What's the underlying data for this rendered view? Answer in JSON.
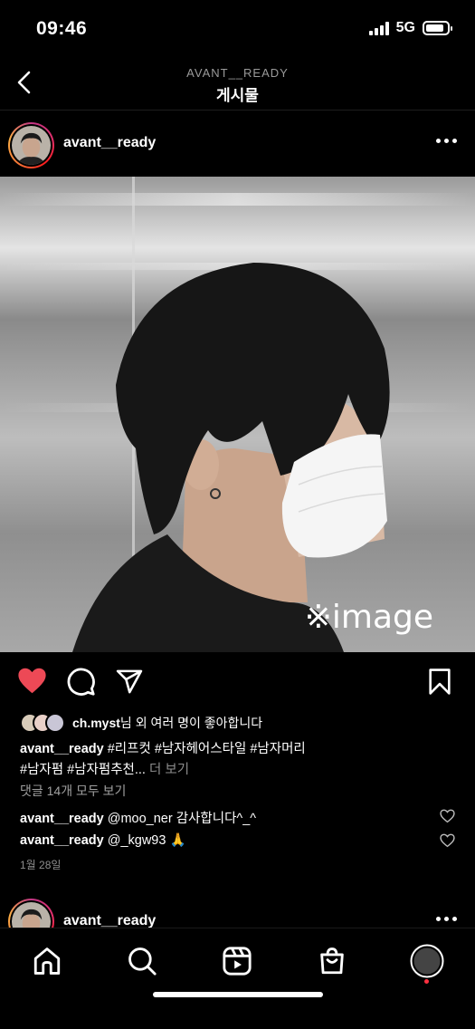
{
  "status_bar": {
    "time": "09:46",
    "network": "5G",
    "battery_level": 0.85
  },
  "header": {
    "account_name": "AVANT__READY",
    "title": "게시물"
  },
  "post": {
    "username": "avant__ready",
    "image_watermark": "※image",
    "liked": true,
    "likes": {
      "first_liker": "ch.myst",
      "text": "님 외 여러 명이 좋아합니다"
    },
    "caption": {
      "username": "avant__ready",
      "line1": "#리프컷 #남자헤어스타일 #남자머리",
      "line2": "#남자펌 #남자펌추천...",
      "more_label": "더 보기"
    },
    "view_comments_label": "댓글 14개 모두 보기",
    "comments": [
      {
        "username": "avant__ready",
        "text": "@moo_ner 감사합니다^_^"
      },
      {
        "username": "avant__ready",
        "text": "@_kgw93 🙏"
      }
    ],
    "date": "1월 28일"
  },
  "next_post": {
    "username": "avant__ready"
  },
  "tab_bar": {
    "items": [
      "home-icon",
      "search-icon",
      "reels-icon",
      "shop-icon",
      "profile-icon"
    ],
    "active_accent": "#ff3040"
  },
  "colors": {
    "background": "#000000",
    "like_red": "#ed4956",
    "muted_text": "#8e8e8e"
  }
}
